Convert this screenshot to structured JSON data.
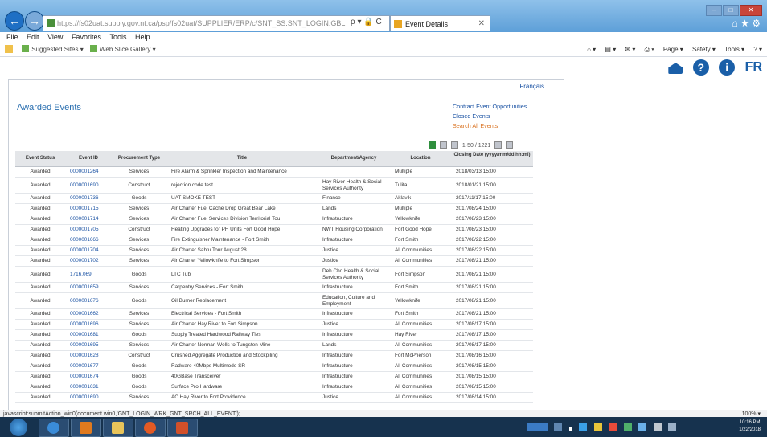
{
  "browser": {
    "address": "https://fs02uat.supply.gov.nt.ca/psp/fs02uat/SUPPLIER/ERP/c/SNT_SS.SNT_LOGIN.GBL",
    "address_tools": "ρ ▾ 🔒 C",
    "tab_label": "Event Details",
    "menu": [
      "File",
      "Edit",
      "View",
      "Favorites",
      "Tools",
      "Help"
    ],
    "favorites": [
      "Suggested Sites ▾",
      "Web Slice Gallery ▾"
    ],
    "commands": [
      "Page ▾",
      "Safety ▾",
      "Tools ▾"
    ]
  },
  "page": {
    "language_link": "Français",
    "title": "Awarded Events",
    "links": [
      "Contract Event Opportunities",
      "Closed Events",
      "Search All Events"
    ],
    "pager": "1-50 / 1221",
    "fr_label": "FR"
  },
  "table": {
    "columns": [
      "Event Status",
      "Event ID",
      "Procurement Type",
      "Title",
      "Department/Agency",
      "Location",
      "Closing Date (yyyy/mm/dd hh:mi)"
    ],
    "rows": [
      {
        "status": "Awarded",
        "id": "0000001264",
        "type": "Services",
        "title": "Fire Alarm & Sprinkler Inspection and Maintenance",
        "dept": "",
        "loc": "Multiple",
        "date": "2018/03/13 15:00"
      },
      {
        "status": "Awarded",
        "id": "0000001690",
        "type": "Construct",
        "title": "rejection code test",
        "dept": "Hay River Health & Social Services Authority",
        "loc": "Tulita",
        "date": "2018/01/21 15:00"
      },
      {
        "status": "Awarded",
        "id": "0000001736",
        "type": "Goods",
        "title": "UAT SMOKE TEST",
        "dept": "Finance",
        "loc": "Aklavik",
        "date": "2017/11/17 15:00"
      },
      {
        "status": "Awarded",
        "id": "0000001715",
        "type": "Services",
        "title": "Air Charter Fuel Cache Drop Great Bear Lake",
        "dept": "Lands",
        "loc": "Multiple",
        "date": "2017/08/24 15:00"
      },
      {
        "status": "Awarded",
        "id": "0000001714",
        "type": "Services",
        "title": "Air Charter Fuel Services Division Territorial Tou",
        "dept": "Infrastructure",
        "loc": "Yellowknife",
        "date": "2017/08/23 15:00"
      },
      {
        "status": "Awarded",
        "id": "0000001705",
        "type": "Construct",
        "title": "Heating Upgrades for PH Units Fort Good Hope",
        "dept": "NWT Housing Corporation",
        "loc": "Fort Good Hope",
        "date": "2017/08/23 15:00"
      },
      {
        "status": "Awarded",
        "id": "0000001666",
        "type": "Services",
        "title": "Fire Extinguisher Maintenance - Fort Smith",
        "dept": "Infrastructure",
        "loc": "Fort Smith",
        "date": "2017/08/22 15:00"
      },
      {
        "status": "Awarded",
        "id": "0000001704",
        "type": "Services",
        "title": "Air Charter Sahtu Tour August 28",
        "dept": "Justice",
        "loc": "All Communities",
        "date": "2017/08/22 15:00"
      },
      {
        "status": "Awarded",
        "id": "0000001702",
        "type": "Services",
        "title": "Air Charter Yellowknife to Fort Simpson",
        "dept": "Justice",
        "loc": "All Communities",
        "date": "2017/08/21 15:00"
      },
      {
        "status": "Awarded",
        "id": "1716.069",
        "type": "Goods",
        "title": "LTC Tub",
        "dept": "Deh Cho Health & Social Services Authority",
        "loc": "Fort Simpson",
        "date": "2017/08/21 15:00"
      },
      {
        "status": "Awarded",
        "id": "0000001659",
        "type": "Services",
        "title": "Carpentry Services - Fort Smith",
        "dept": "Infrastructure",
        "loc": "Fort Smith",
        "date": "2017/08/21 15:00"
      },
      {
        "status": "Awarded",
        "id": "0000001676",
        "type": "Goods",
        "title": "Oil Burner Replacement",
        "dept": "Education, Culture and Employment",
        "loc": "Yellowknife",
        "date": "2017/08/21 15:00"
      },
      {
        "status": "Awarded",
        "id": "0000001662",
        "type": "Services",
        "title": "Electrical Services - Fort Smith",
        "dept": "Infrastructure",
        "loc": "Fort Smith",
        "date": "2017/08/21 15:00"
      },
      {
        "status": "Awarded",
        "id": "0000001696",
        "type": "Services",
        "title": "Air Charter Hay River to Fort Simpson",
        "dept": "Justice",
        "loc": "All Communities",
        "date": "2017/08/17 15:00"
      },
      {
        "status": "Awarded",
        "id": "0000001681",
        "type": "Goods",
        "title": "Supply Treated Hardwood Railway Ties",
        "dept": "Infrastructure",
        "loc": "Hay River",
        "date": "2017/08/17 15:00"
      },
      {
        "status": "Awarded",
        "id": "0000001695",
        "type": "Services",
        "title": "Air Charter Norman Wells to Tungsten Mine",
        "dept": "Lands",
        "loc": "All Communities",
        "date": "2017/08/17 15:00"
      },
      {
        "status": "Awarded",
        "id": "0000001628",
        "type": "Construct",
        "title": "Crushed Aggregate Production and Stockpiling",
        "dept": "Infrastructure",
        "loc": "Fort McPherson",
        "date": "2017/08/16 15:00"
      },
      {
        "status": "Awarded",
        "id": "0000001677",
        "type": "Goods",
        "title": "Radware 40Mbps Multimode SR",
        "dept": "Infrastructure",
        "loc": "All Communities",
        "date": "2017/08/15 15:00"
      },
      {
        "status": "Awarded",
        "id": "0000001674",
        "type": "Goods",
        "title": "40GBase Transceiver",
        "dept": "Infrastructure",
        "loc": "All Communities",
        "date": "2017/08/15 15:00"
      },
      {
        "status": "Awarded",
        "id": "0000001631",
        "type": "Goods",
        "title": "Surface Pro Hardware",
        "dept": "Infrastructure",
        "loc": "All Communities",
        "date": "2017/08/15 15:00"
      },
      {
        "status": "Awarded",
        "id": "0000001690",
        "type": "Services",
        "title": "AC Hay River to Fort Providence",
        "dept": "Justice",
        "loc": "All Communities",
        "date": "2017/08/14 15:00"
      }
    ]
  },
  "status": {
    "text": "javascript:submitAction_win0(document.win0,'GNT_LOGIN_WRK_GNT_SRCH_ALL_EVENT');",
    "zoom": "100% ▾"
  },
  "taskbar": {
    "time": "10:16 PM",
    "date": "1/22/2018"
  },
  "colors": {
    "link": "#1a52a3",
    "accent_orange": "#d9711f",
    "header_bg": "#e4e6e9",
    "icon_blue": "#1a5fa8"
  }
}
